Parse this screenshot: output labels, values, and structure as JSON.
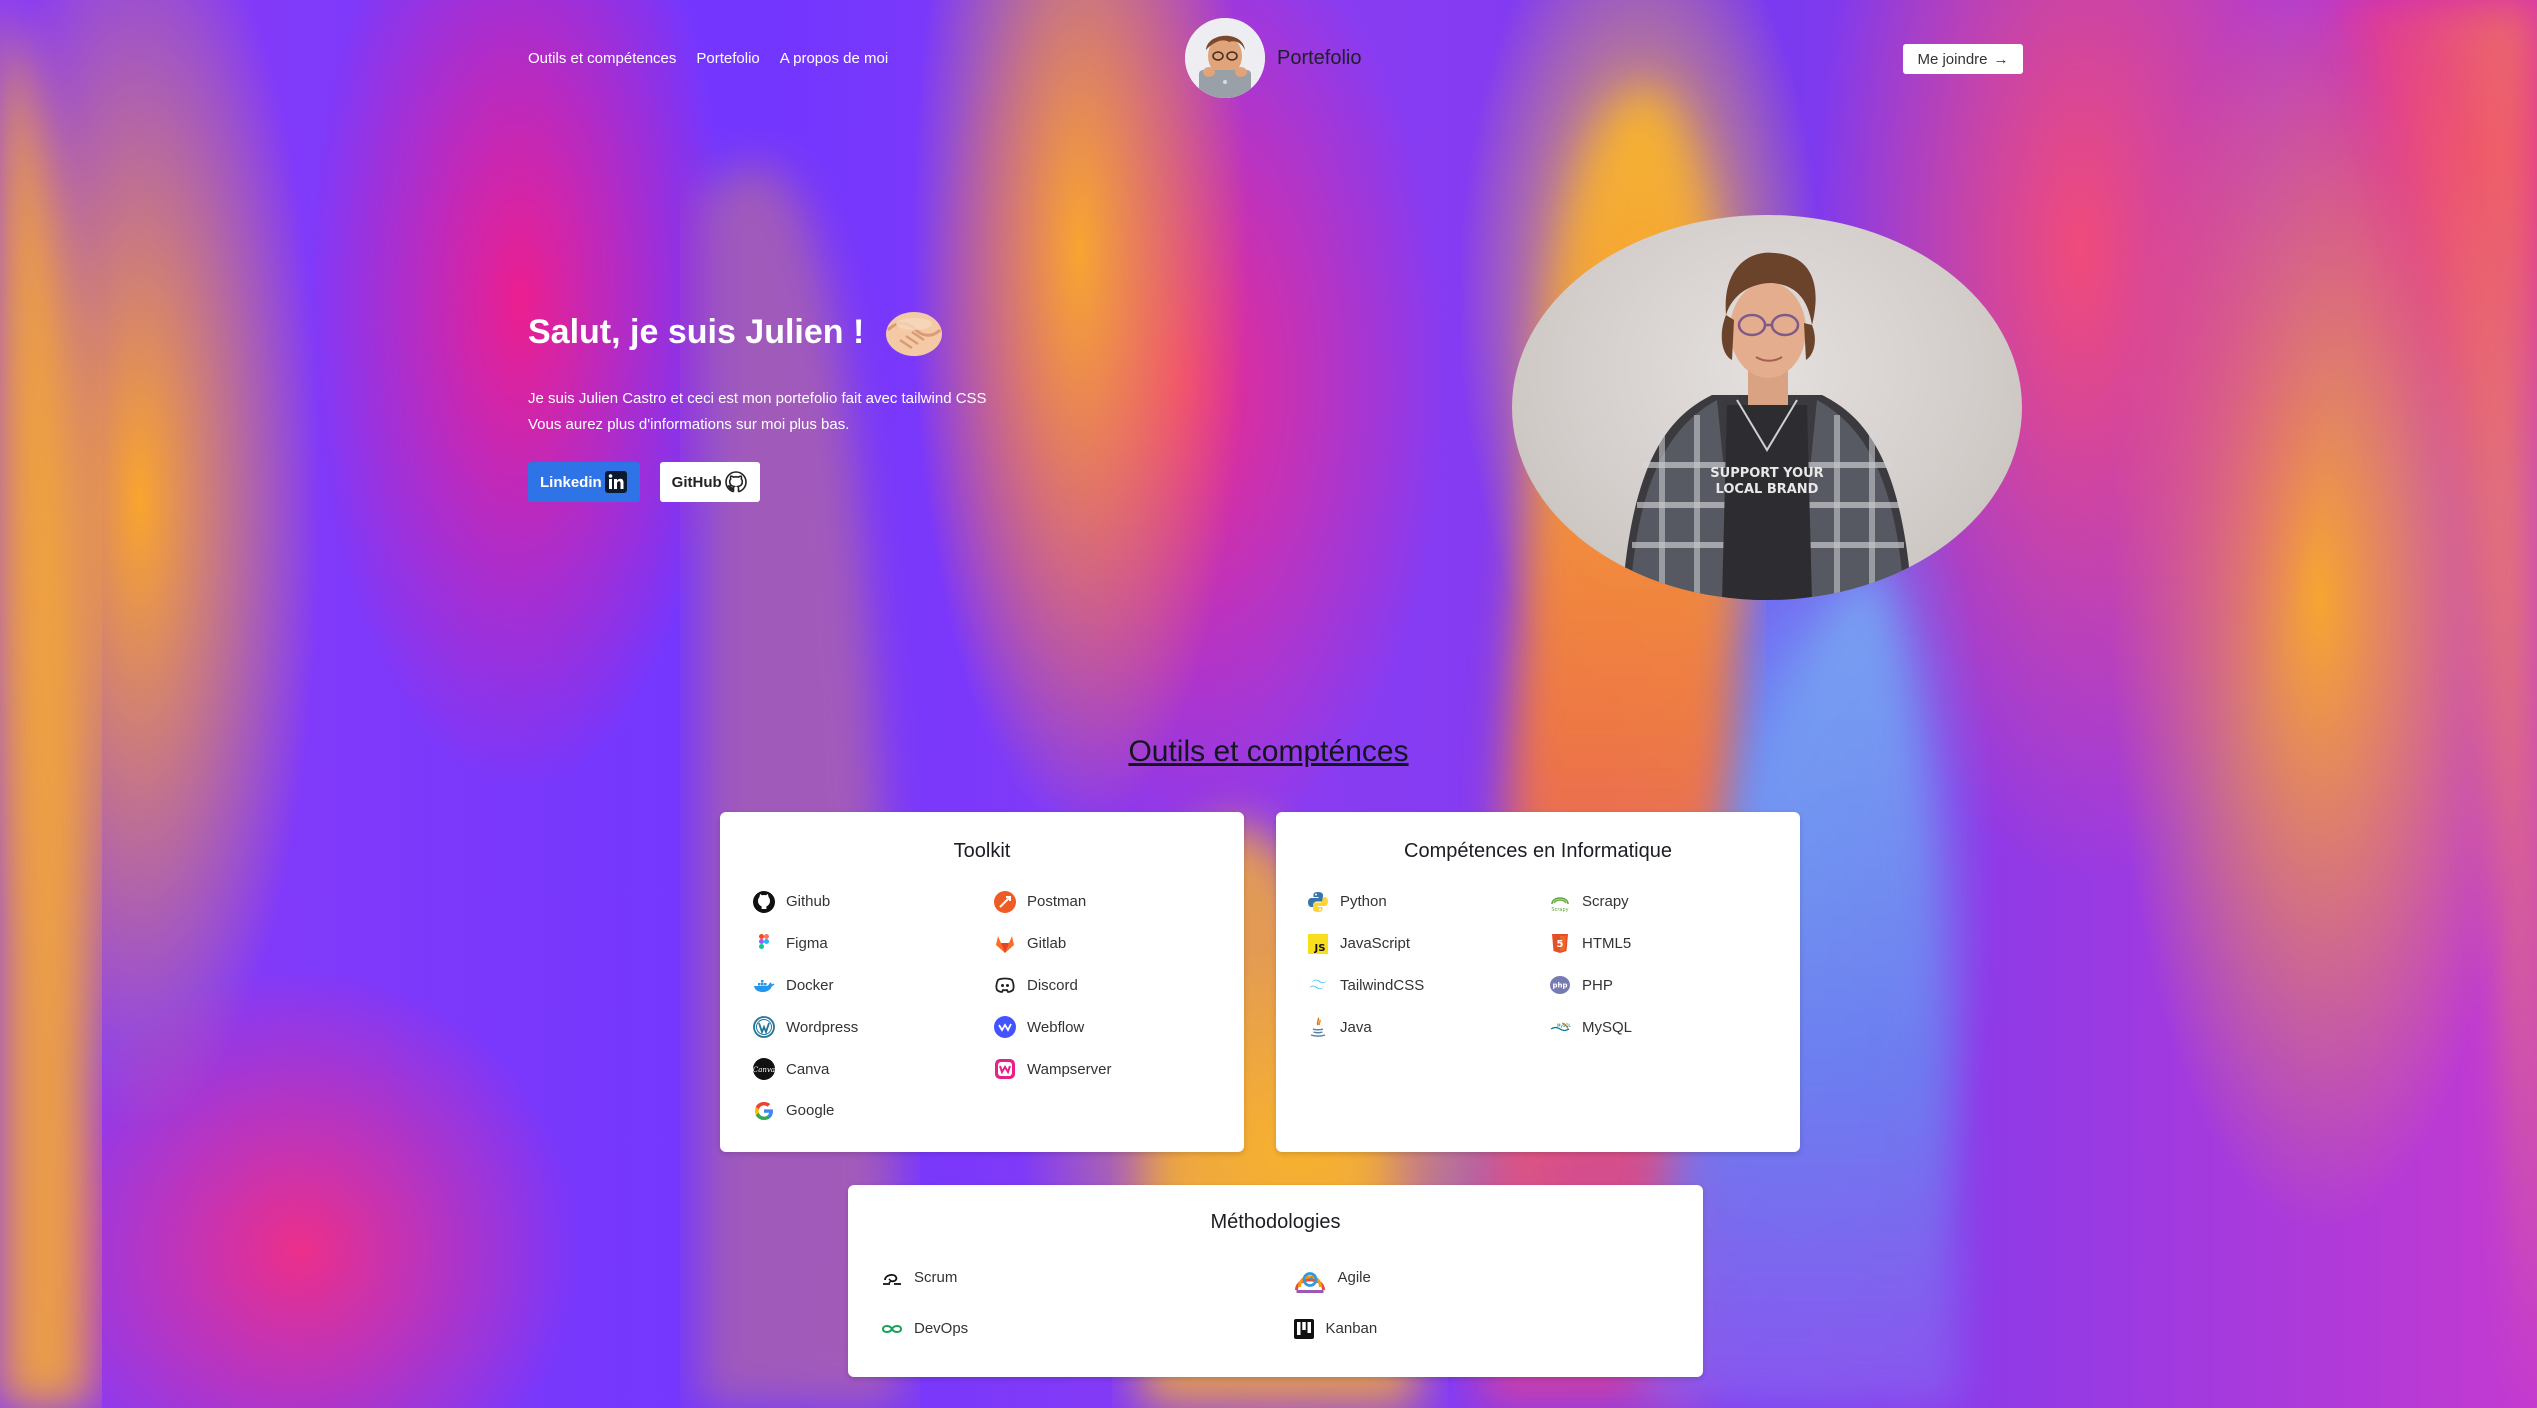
{
  "nav": {
    "links": [
      "Outils et compétences",
      "Portefolio",
      "A propos de moi"
    ],
    "brand": "Portefolio",
    "contact_button": "Me joindre"
  },
  "hero": {
    "title": "Salut, je suis Julien !",
    "line1": "Je suis Julien Castro et ceci est mon portefolio fait avec tailwind CSS",
    "line2": "Vous aurez plus d'informations sur moi plus bas.",
    "linkedin_label": "Linkedin",
    "github_label": "GitHub",
    "tshirt_line1": "SUPPORT YOUR",
    "tshirt_line2": "LOCAL BRAND"
  },
  "skills": {
    "section_title": "Outils et compténces",
    "toolkit": {
      "title": "Toolkit",
      "items": [
        {
          "label": "Github",
          "icon": "github-icon"
        },
        {
          "label": "Postman",
          "icon": "postman-icon"
        },
        {
          "label": "Figma",
          "icon": "figma-icon"
        },
        {
          "label": "Gitlab",
          "icon": "gitlab-icon"
        },
        {
          "label": "Docker",
          "icon": "docker-icon"
        },
        {
          "label": "Discord",
          "icon": "discord-icon"
        },
        {
          "label": "Wordpress",
          "icon": "wordpress-icon"
        },
        {
          "label": "Webflow",
          "icon": "webflow-icon"
        },
        {
          "label": "Canva",
          "icon": "canva-icon"
        },
        {
          "label": "Wampserver",
          "icon": "wampserver-icon"
        },
        {
          "label": "Google",
          "icon": "google-icon"
        }
      ]
    },
    "informatique": {
      "title": "Compétences en Informatique",
      "items": [
        {
          "label": "Python",
          "icon": "python-icon"
        },
        {
          "label": "Scrapy",
          "icon": "scrapy-icon"
        },
        {
          "label": "JavaScript",
          "icon": "javascript-icon"
        },
        {
          "label": "HTML5",
          "icon": "html5-icon"
        },
        {
          "label": "TailwindCSS",
          "icon": "tailwindcss-icon"
        },
        {
          "label": "PHP",
          "icon": "php-icon"
        },
        {
          "label": "Java",
          "icon": "java-icon"
        },
        {
          "label": "MySQL",
          "icon": "mysql-icon"
        }
      ]
    },
    "methodologies": {
      "title": "Méthodologies",
      "items": [
        {
          "label": "Scrum",
          "icon": "scrum-icon"
        },
        {
          "label": "Agile",
          "icon": "agile-icon"
        },
        {
          "label": "DevOps",
          "icon": "devops-icon"
        },
        {
          "label": "Kanban",
          "icon": "kanban-icon"
        }
      ]
    }
  }
}
